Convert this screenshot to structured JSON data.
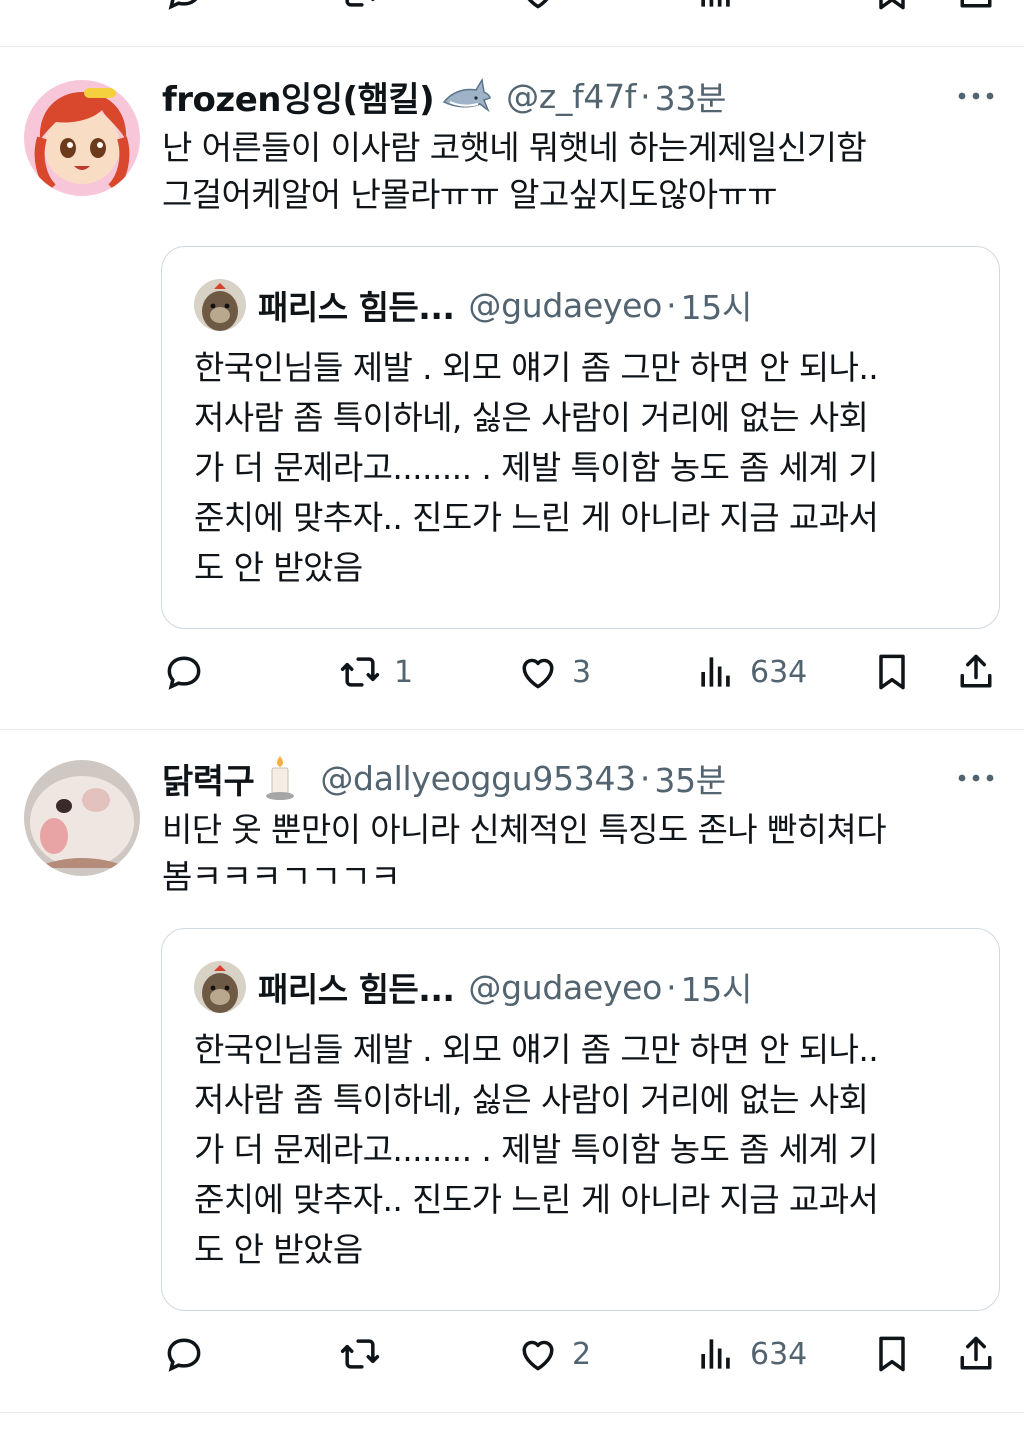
{
  "tweets": [
    {
      "name": "frozen잉잉(햄킬)",
      "badge_icon": "shark-icon",
      "handle": "@z_f47f",
      "separator": "·",
      "time": "33분",
      "text_lines": [
        "난 어른들이 이사람 코햇네 뭐햇네 하는게제일신기함",
        "그걸어케알어 난몰라ㅠㅠ 알고싶지도않아ㅠㅠ"
      ],
      "quote": {
        "name": "패리스 힘든...",
        "handle": "@gudaeyeo",
        "separator": "·",
        "time": "15시",
        "text_lines": [
          "한국인님들 제발 . 외모 얘기 좀 그만 하면 안 되나..",
          "저사람 좀 특이하네, 싫은 사람이 거리에 없는 사회",
          "가 더 문제라고........ . 제발 특이함 농도 좀 세계 기",
          "준치에 맞추자.. 진도가 느린 게 아니라 지금 교과서",
          "도 안 받았음"
        ]
      },
      "stats": {
        "retweets": "1",
        "likes": "3",
        "views": "634"
      }
    },
    {
      "name": "닭력구",
      "badge_icon": "candle-icon",
      "handle": "@dallyeoggu95343",
      "separator": "·",
      "time": "35분",
      "text_lines": [
        "비단 옷 뿐만이 아니라 신체적인 특징도 존나 빤히쳐다",
        "봄ㅋㅋㅋㄱㄱㄱㅋ"
      ],
      "quote": {
        "name": "패리스 힘든...",
        "handle": "@gudaeyeo",
        "separator": "·",
        "time": "15시",
        "text_lines": [
          "한국인님들 제발 . 외모 얘기 좀 그만 하면 안 되나..",
          "저사람 좀 특이하네, 싫은 사람이 거리에 없는 사회",
          "가 더 문제라고........ . 제발 특이함 농도 좀 세계 기",
          "준치에 맞추자.. 진도가 느린 게 아니라 지금 교과서",
          "도 안 받았음"
        ]
      },
      "stats": {
        "retweets": "",
        "likes": "2",
        "views": "634"
      }
    }
  ],
  "colors": {
    "text": "#0f1419",
    "secondary": "#536471",
    "border": "#cfd9de",
    "divider": "#e6e9eb"
  },
  "icons": [
    "reply-icon",
    "retweet-icon",
    "like-icon",
    "views-icon",
    "bookmark-icon",
    "share-icon",
    "more-icon"
  ]
}
